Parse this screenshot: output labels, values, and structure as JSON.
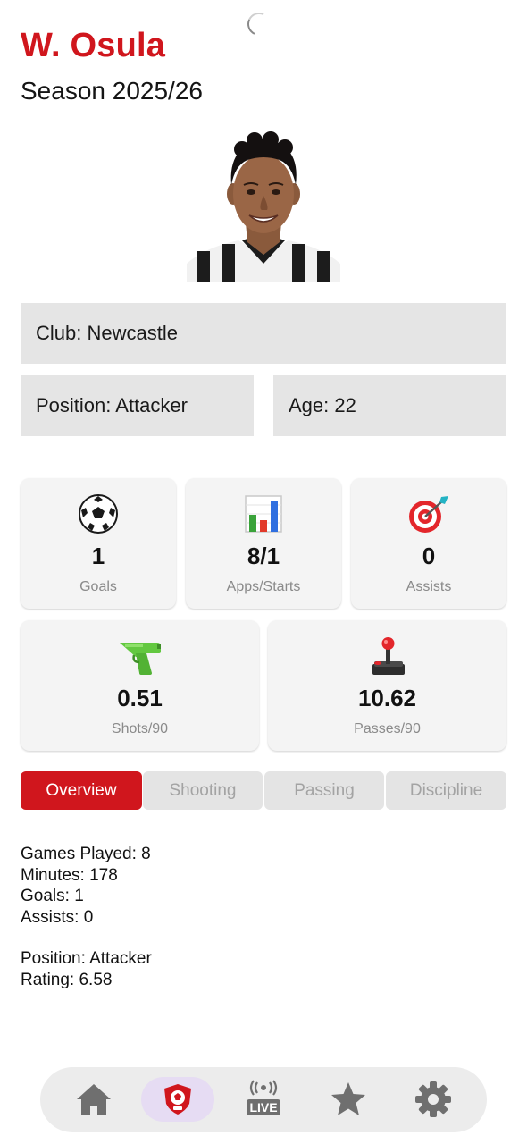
{
  "header": {
    "player_name": "W. Osula",
    "season": "Season 2025/26"
  },
  "info": {
    "club": "Club: Newcastle",
    "position": "Position: Attacker",
    "age": "Age: 22"
  },
  "stat_cards": [
    {
      "icon": "soccer-ball-icon",
      "value": "1",
      "label": "Goals"
    },
    {
      "icon": "bar-chart-icon",
      "value": "8/1",
      "label": "Apps/Starts"
    },
    {
      "icon": "target-dart-icon",
      "value": "0",
      "label": "Assists"
    },
    {
      "icon": "water-pistol-icon",
      "value": "0.51",
      "label": "Shots/90"
    },
    {
      "icon": "joystick-icon",
      "value": "10.62",
      "label": "Passes/90"
    }
  ],
  "tabs": [
    {
      "label": "Overview",
      "active": true
    },
    {
      "label": "Shooting",
      "active": false
    },
    {
      "label": "Passing",
      "active": false
    },
    {
      "label": "Discipline",
      "active": false
    }
  ],
  "overview": {
    "games_played": "Games Played: 8",
    "minutes": "Minutes: 178",
    "goals": "Goals: 1",
    "assists": "Assists: 0",
    "position": "Position: Attacker",
    "rating": "Rating: 6.58"
  },
  "bottom_nav": [
    {
      "icon": "home-icon",
      "active": false
    },
    {
      "icon": "club-badge-icon",
      "active": true
    },
    {
      "icon": "live-icon",
      "label": "LIVE",
      "active": false
    },
    {
      "icon": "star-icon",
      "active": false
    },
    {
      "icon": "gear-icon",
      "active": false
    }
  ],
  "colors": {
    "accent": "#d0161d",
    "nav_icon": "#6f6f6f",
    "active_nav_bg": "#e6dcf3"
  }
}
